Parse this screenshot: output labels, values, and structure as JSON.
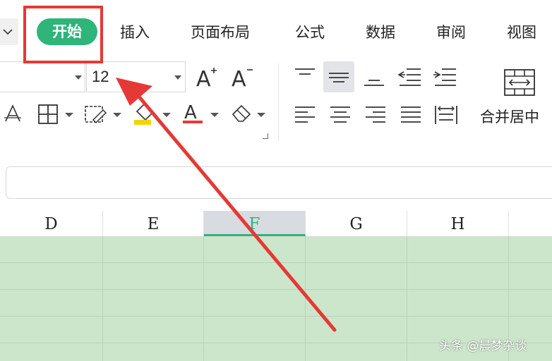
{
  "ribbon": {
    "tabs": [
      {
        "label": "开始",
        "active": true
      },
      {
        "label": "插入"
      },
      {
        "label": "页面布局"
      },
      {
        "label": "公式"
      },
      {
        "label": "数据"
      },
      {
        "label": "审阅"
      },
      {
        "label": "视图"
      }
    ],
    "font_size": "12",
    "merge_label": "合并居中",
    "icons": [
      "font-size-increase-icon",
      "font-size-decrease-icon",
      "text-effect-icon",
      "border-icon",
      "fill-format-icon",
      "highlight-icon",
      "font-color-icon",
      "eraser-icon",
      "align-top-icon",
      "align-middle-icon",
      "align-bottom-icon",
      "decrease-indent-icon",
      "increase-indent-icon",
      "align-left-icon",
      "align-center-icon",
      "align-right-icon",
      "justify-icon",
      "distributed-icon",
      "merge-center-icon"
    ],
    "accent_color": "#2fb47a",
    "font_color_underline": "#e53935"
  },
  "sheet": {
    "columns": [
      "D",
      "E",
      "F",
      "G",
      "H"
    ],
    "selected_column": "F",
    "cell_fill": "#cce6cc"
  },
  "annotation": {
    "color": "#e53935"
  },
  "watermark": "头条 @晨梦杂谈"
}
